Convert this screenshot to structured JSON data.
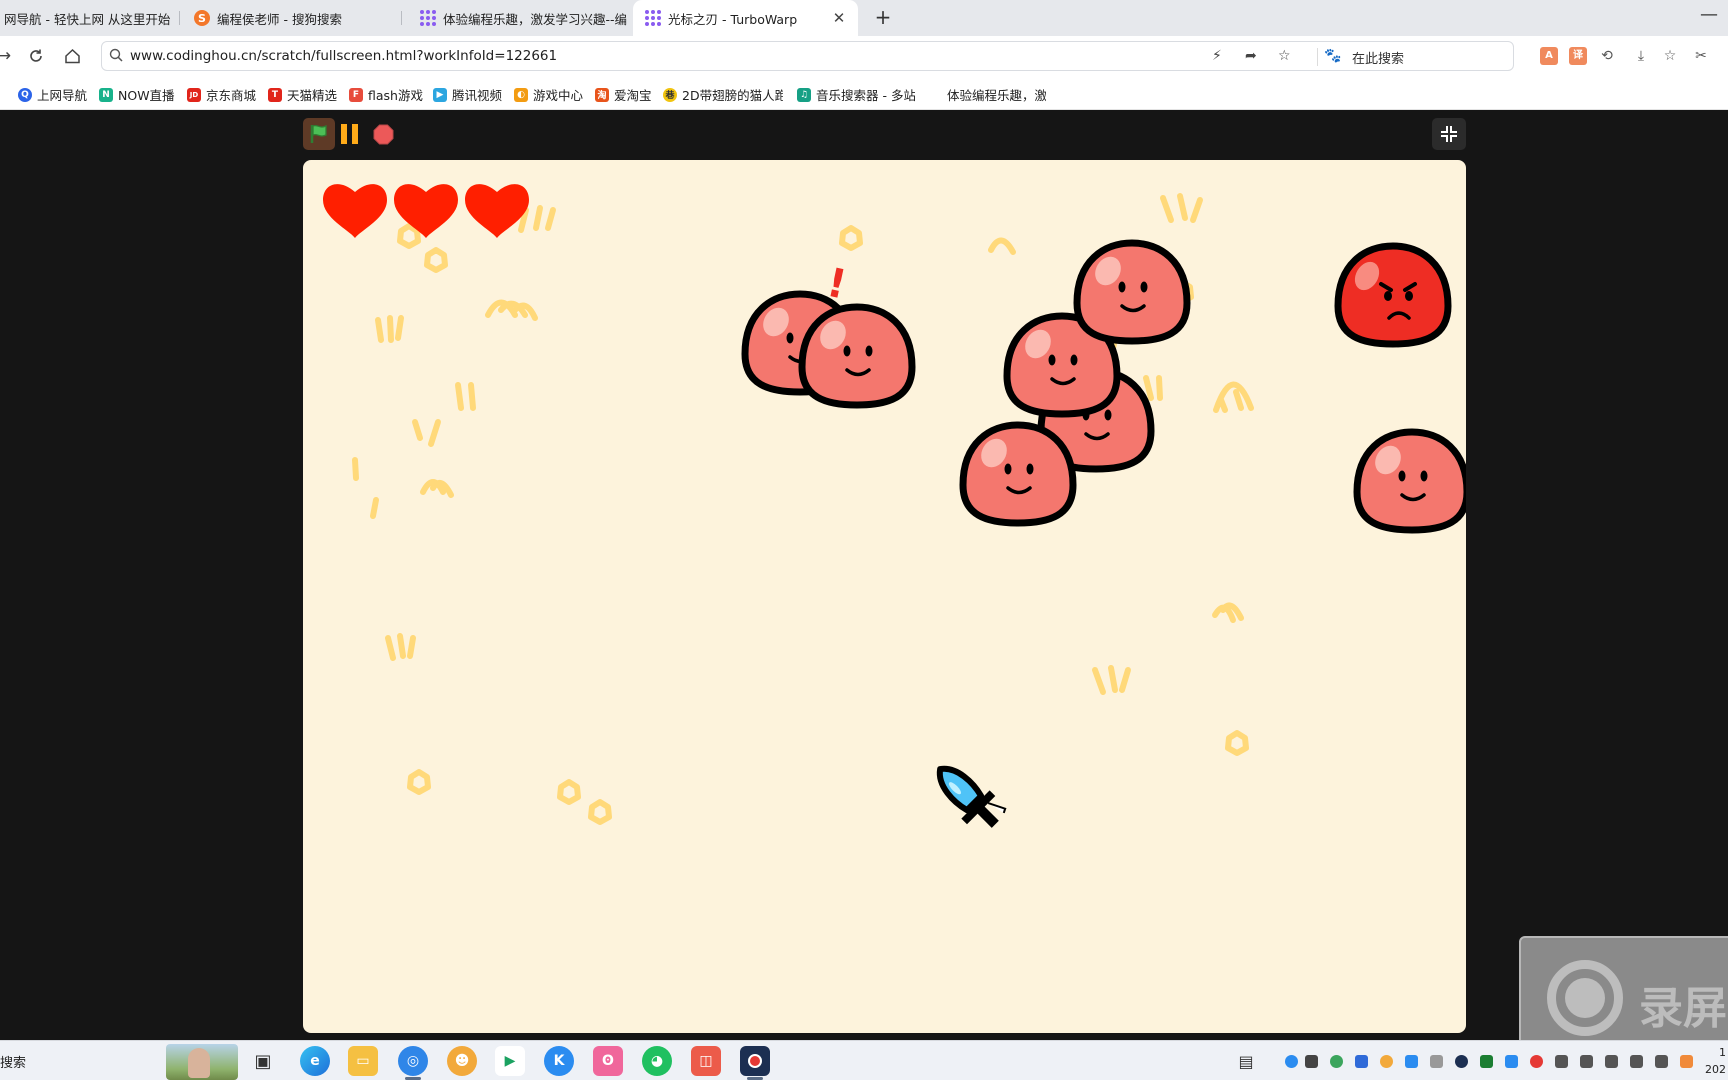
{
  "tabs": [
    {
      "title": "网导航 - 轻快上网 从这里开始",
      "active": false
    },
    {
      "title": "编程侯老师 - 搜狗搜索",
      "active": false
    },
    {
      "title": "体验编程乐趣，激发学习兴趣--编",
      "active": false
    },
    {
      "title": "光标之刃 - TurboWarp",
      "active": true
    }
  ],
  "toolbar": {
    "url": "www.codinghou.cn/scratch/fullscreen.html?workInfoId=122661",
    "search_placeholder": "在此搜索"
  },
  "bookmarks": [
    {
      "label": "上网导航",
      "color": "#2b63e8",
      "glyph": "Q"
    },
    {
      "label": "NOW直播",
      "color": "#18b28b",
      "glyph": "N"
    },
    {
      "label": "京东商城",
      "color": "#e1251b",
      "glyph": "JD"
    },
    {
      "label": "天猫精选",
      "color": "#e1251b",
      "glyph": "T"
    },
    {
      "label": "flash游戏",
      "color": "#e74c3c",
      "glyph": "F"
    },
    {
      "label": "腾讯视频",
      "color": "#2ca6e0",
      "glyph": "▶"
    },
    {
      "label": "游戏中心",
      "color": "#f39c12",
      "glyph": "◐"
    },
    {
      "label": "爱淘宝",
      "color": "#e8541b",
      "glyph": "淘"
    },
    {
      "label": "2D带翅膀的猫人跑",
      "color": "#f1c40f",
      "glyph": "巷"
    },
    {
      "label": "音乐搜索器 - 多站",
      "color": "#16a085",
      "glyph": "♫"
    },
    {
      "label": "体验编程乐趣，激",
      "color": "#8a5cf0",
      "glyph": "⋮"
    }
  ],
  "game": {
    "lives": 3,
    "colors": {
      "background": "#fdf3dc",
      "doodle": "#ffd97a",
      "slime": "#f4776e",
      "angry_slime": "#ee2d24",
      "heart": "#ff1f00",
      "cursor": "#4fc3f7"
    },
    "alert_mark": "!"
  },
  "recorder": {
    "label": "录屏"
  },
  "taskbar": {
    "search_label": "搜索",
    "clock_time": "1",
    "clock_date": "202"
  }
}
